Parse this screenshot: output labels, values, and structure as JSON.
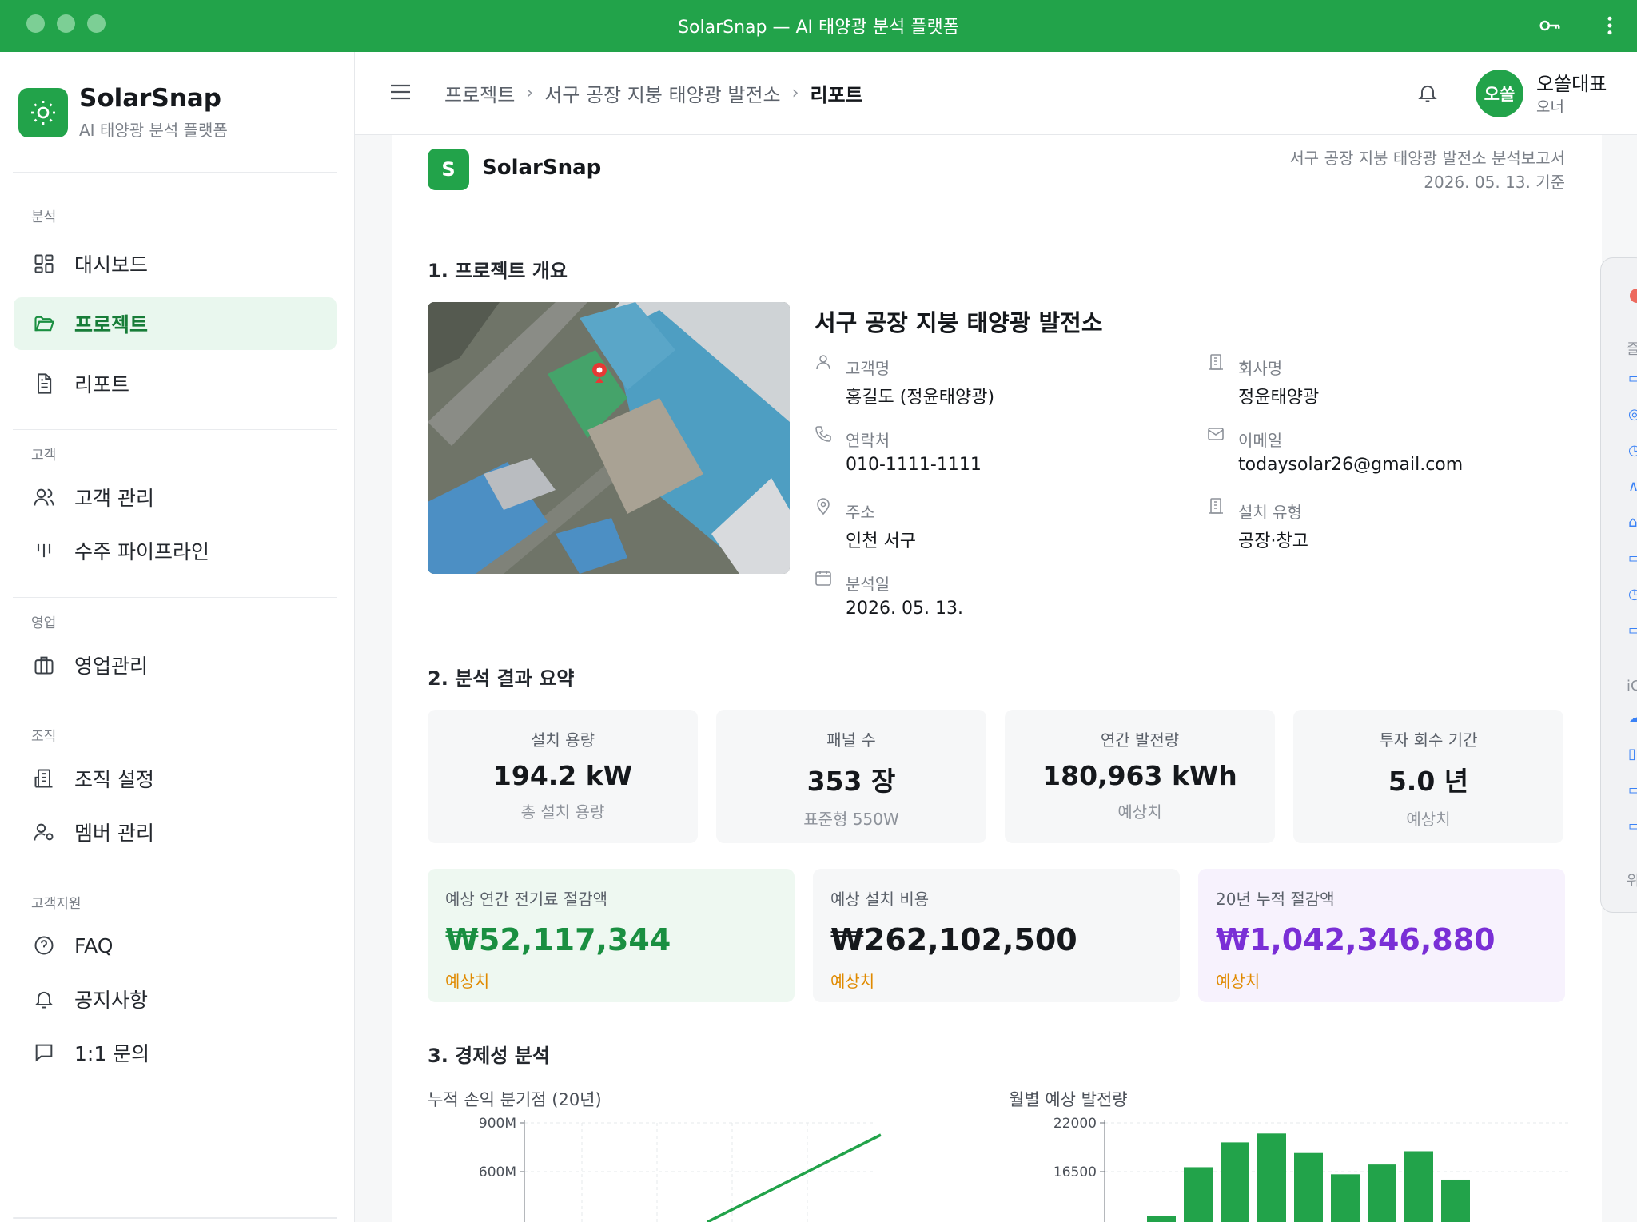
{
  "window": {
    "title": "SolarSnap — AI 태양광 분석 플랫폼"
  },
  "sidebar": {
    "brand_name": "SolarSnap",
    "brand_sub": "AI 태양광 분석 플랫폼",
    "sections": {
      "analysis": "분석",
      "customer": "고객",
      "sales": "영업",
      "org": "조직",
      "support": "고객지원"
    },
    "items": {
      "dashboard": "대시보드",
      "projects": "프로젝트",
      "reports": "리포트",
      "customers": "고객 관리",
      "pipeline": "수주 파이프라인",
      "sales": "영업관리",
      "org_settings": "조직 설정",
      "members": "멤버 관리",
      "faq": "FAQ",
      "notices": "공지사항",
      "inquiry": "1:1 문의"
    },
    "active": "projects"
  },
  "header": {
    "breadcrumb": [
      "프로젝트",
      "서구 공장 지붕 태양광 발전소",
      "리포트"
    ],
    "user": {
      "avatar": "오쏠",
      "name": "오쏠대표",
      "role": "오너"
    }
  },
  "report": {
    "logo_letter": "S",
    "brand": "SolarSnap",
    "doc_title": "서구 공장 지붕 태양광 발전소 분석보고서",
    "doc_date": "2026. 05. 13. 기준",
    "sec1": "1. 프로젝트 개요",
    "project_name": "서구 공장 지붕 태양광 발전소",
    "info": {
      "customer": {
        "label": "고객명",
        "value": "홍길도 (정윤태양광)"
      },
      "company": {
        "label": "회사명",
        "value": "정윤태양광"
      },
      "phone": {
        "label": "연락처",
        "value": "010-1111-1111"
      },
      "email": {
        "label": "이메일",
        "value": "todaysolar26@gmail.com"
      },
      "address": {
        "label": "주소",
        "value": "인천 서구"
      },
      "install_type": {
        "label": "설치 유형",
        "value": "공장·창고"
      },
      "date": {
        "label": "분석일",
        "value": "2026. 05. 13."
      }
    },
    "sec2": "2. 분석 결과 요약",
    "stats": [
      {
        "label": "설치 용량",
        "value": "194.2 kW",
        "sub": "총 설치 용량"
      },
      {
        "label": "패널 수",
        "value": "353 장",
        "sub": "표준형 550W"
      },
      {
        "label": "연간 발전량",
        "value": "180,963 kWh",
        "sub": "예상치"
      },
      {
        "label": "투자 회수 기간",
        "value": "5.0 년",
        "sub": "예상치"
      }
    ],
    "money": [
      {
        "label": "예상 연간 전기료 절감액",
        "value": "₩52,117,344",
        "est": "예상치",
        "color": "#1a8f41",
        "bg": "#eef8f1"
      },
      {
        "label": "예상 설치 비용",
        "value": "₩262,102,500",
        "est": "예상치",
        "color": "#15181c",
        "bg": "#f6f7f8"
      },
      {
        "label": "20년 누적 절감액",
        "value": "₩1,042,346,880",
        "est": "예상치",
        "color": "#7a2fd6",
        "bg": "#f7f2fd"
      }
    ],
    "sec3": "3. 경제성 분석"
  },
  "chart_data": [
    {
      "type": "line",
      "title": "누적 손익 분기점 (20년)",
      "yticks": [
        "900M",
        "600M"
      ],
      "ylim": [
        0,
        900000000
      ],
      "color": "#22a34a"
    },
    {
      "type": "bar",
      "title": "월별 예상 발전량",
      "yticks": [
        "22000",
        "16500"
      ],
      "ylim": [
        0,
        22000
      ],
      "values": [
        11500,
        17000,
        19800,
        20800,
        18600,
        16200,
        17300,
        18800,
        15600
      ],
      "color": "#22a34a"
    }
  ]
}
